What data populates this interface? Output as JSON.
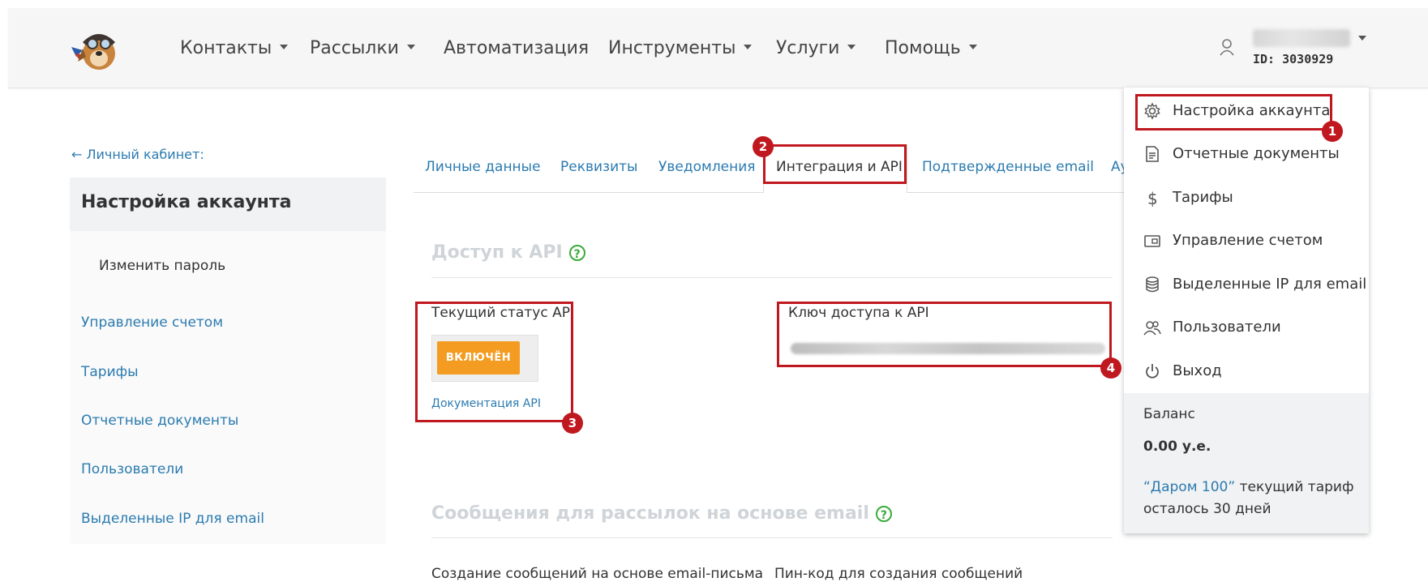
{
  "header": {
    "nav": [
      {
        "label": "Контакты",
        "caret": true
      },
      {
        "label": "Рассылки",
        "caret": true
      },
      {
        "label": "Автоматизация",
        "caret": false
      },
      {
        "label": "Инструменты",
        "caret": true
      },
      {
        "label": "Услуги",
        "caret": true
      },
      {
        "label": "Помощь",
        "caret": true
      }
    ],
    "user_id": "ID: 3030929"
  },
  "sidebar": {
    "back_link": "← Личный кабинет:",
    "active": "Настройка аккаунта",
    "sub_item": "Изменить пароль",
    "links": [
      "Управление счетом",
      "Тарифы",
      "Отчетные документы",
      "Пользователи",
      "Выделенные IP для email"
    ]
  },
  "tabs": [
    "Личные данные",
    "Реквизиты",
    "Уведомления",
    "Интеграция и API",
    "Подтвержденные email",
    "Ау"
  ],
  "api": {
    "section_title": "Доступ к API",
    "status_label": "Текущий статус API",
    "status_value": "ВКЛЮЧЁН",
    "doc_link": "Документация API",
    "key_label": "Ключ доступа к API"
  },
  "messages": {
    "section_title": "Сообщения для рассылок на основе email",
    "label1": "Создание сообщений на основе email-письма",
    "label2": "Пин-код для создания сообщений"
  },
  "annotations": [
    "1",
    "2",
    "3",
    "4"
  ],
  "dropdown": {
    "items": [
      {
        "label": "Настройка аккаунта",
        "icon": "gear-icon"
      },
      {
        "label": "Отчетные документы",
        "icon": "document-icon"
      },
      {
        "label": "Тарифы",
        "icon": "dollar-icon"
      },
      {
        "label": "Управление счетом",
        "icon": "wallet-icon"
      },
      {
        "label": "Выделенные IP для email",
        "icon": "database-icon"
      },
      {
        "label": "Пользователи",
        "icon": "users-icon"
      },
      {
        "label": "Выход",
        "icon": "power-icon"
      }
    ],
    "balance_label": "Баланс",
    "balance_value": "0.00 у.е.",
    "tariff_name": "“Даром 100”",
    "tariff_suffix": " текущий тариф",
    "days_left": "осталось 30 дней"
  },
  "colors": {
    "accent": "#2b7bb0",
    "status": "#f39c21",
    "annotation": "#c0181f",
    "help": "#3aab3a"
  }
}
